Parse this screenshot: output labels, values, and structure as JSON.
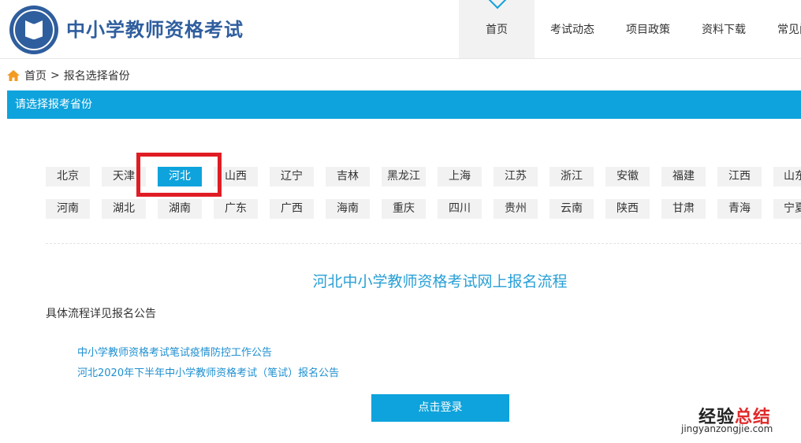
{
  "header": {
    "site_title": "中小学教师资格考试",
    "nav": [
      {
        "label": "首页",
        "active": true
      },
      {
        "label": "考试动态"
      },
      {
        "label": "项目政策"
      },
      {
        "label": "资料下载"
      },
      {
        "label": "常见问题"
      }
    ]
  },
  "breadcrumb": {
    "home": "首页",
    "separator": ">",
    "current": "报名选择省份"
  },
  "section_title": "请选择报考省份",
  "provinces_row1": [
    "北京",
    "天津",
    "河北",
    "山西",
    "辽宁",
    "吉林",
    "黑龙江",
    "上海",
    "江苏",
    "浙江",
    "安徽",
    "福建",
    "江西",
    "山东"
  ],
  "provinces_row2": [
    "河南",
    "湖北",
    "湖南",
    "广东",
    "广西",
    "海南",
    "重庆",
    "四川",
    "贵州",
    "云南",
    "陕西",
    "甘肃",
    "青海",
    "宁夏"
  ],
  "selected_province": "河北",
  "flow": {
    "title": "河北中小学教师资格考试网上报名流程",
    "note": "具体流程详见报名公告",
    "notices": [
      "中小学教师资格考试笔试疫情防控工作公告",
      "河北2020年下半年中小学教师资格考试（笔试）报名公告"
    ],
    "login_label": "点击登录"
  },
  "watermark": {
    "cn_main": "经验",
    "cn_accent": "总结",
    "en": "jingyanzongjie.com"
  },
  "colors": {
    "accent": "#0ea3dc",
    "highlight": "#e01d24",
    "brand": "#2f5e9e"
  }
}
